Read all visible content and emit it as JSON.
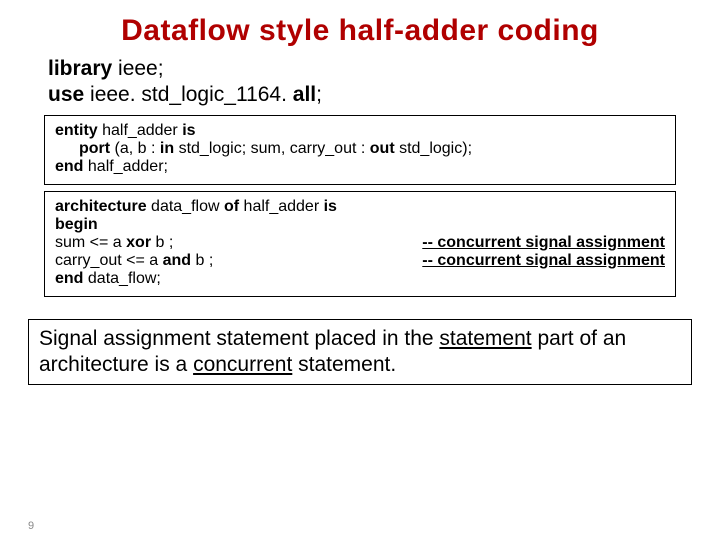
{
  "title": "Dataflow style half-adder coding",
  "lib": {
    "library_kw": "library",
    "library_rest": " ieee;",
    "use_kw": "use",
    "use_rest": " ieee. std_logic_1164. ",
    "all_kw": "all",
    "semi": ";"
  },
  "entity": {
    "l1_b1": "entity",
    "l1_t1": " half_adder ",
    "l1_b2": "is",
    "l2_b1": "port ",
    "l2_t1": "(a, b : ",
    "l2_b2": "in",
    "l2_t2": " std_logic;   sum, carry_out : ",
    "l2_b3": "out",
    "l2_t3": " std_logic);",
    "l3_b1": "end",
    "l3_t1": " half_adder;"
  },
  "arch": {
    "l1_b1": "architecture",
    "l1_t1": " data_flow ",
    "l1_b2": "of",
    "l1_t2": " half_adder  ",
    "l1_b3": "is",
    "l2_b1": "begin",
    "l3_left_a": "sum  <=  a ",
    "l3_left_b": "xor",
    "l3_left_c": " b ;",
    "l3_right": "-- concurrent signal assignment",
    "l4_left_a": "carry_out  <=  a ",
    "l4_left_b": "and",
    "l4_left_c": " b ;",
    "l4_right": "-- concurrent signal assignment",
    "l5_b1": "end",
    "l5_t1": " data_flow;"
  },
  "footer": {
    "t1": "Signal assignment statement placed in the ",
    "u1": "statement",
    "t2": " part of an architecture is a ",
    "u2": "concurrent",
    "t3": " statement."
  },
  "page": "9"
}
